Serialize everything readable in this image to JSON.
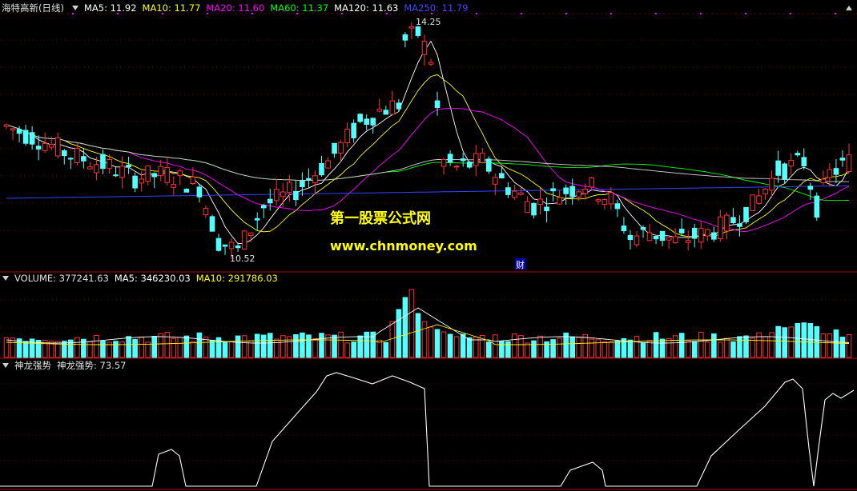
{
  "main_pane": {
    "stock_name": "海特高新(日线)",
    "indicators": [
      {
        "text": "MA5: 11.92",
        "color": "#ffffff"
      },
      {
        "text": "MA10: 11.77",
        "color": "#ffff00"
      },
      {
        "text": "MA20: 11.60",
        "color": "#ff00ff"
      },
      {
        "text": "MA60: 11.37",
        "color": "#00ff00"
      },
      {
        "text": "MA120: 11.63",
        "color": "#ffffff"
      },
      {
        "text": "MA250: 11.79",
        "color": "#4444ff"
      }
    ],
    "high_label": "14.25",
    "low_label": "10.52",
    "watermark_cn": "第一股票公式网",
    "watermark_url": "www.chnmoney.com",
    "finance_marker": "财"
  },
  "volume_pane": {
    "title": "VOLUME: 377241.63",
    "ma5": "MA5: 346230.03",
    "ma10": "MA10: 291786.03"
  },
  "indicator_pane": {
    "name": "神龙强势",
    "value": "神龙强势: 73.57"
  },
  "colors": {
    "up": "#ff3232",
    "down": "#54ffff",
    "axis": "#b00000",
    "grid": "#700000"
  },
  "chart_data": {
    "type": "candlestick",
    "x": [],
    "price_extremes": {
      "high": 14.25,
      "low": 10.52
    },
    "note": "",
    "series": []
  }
}
